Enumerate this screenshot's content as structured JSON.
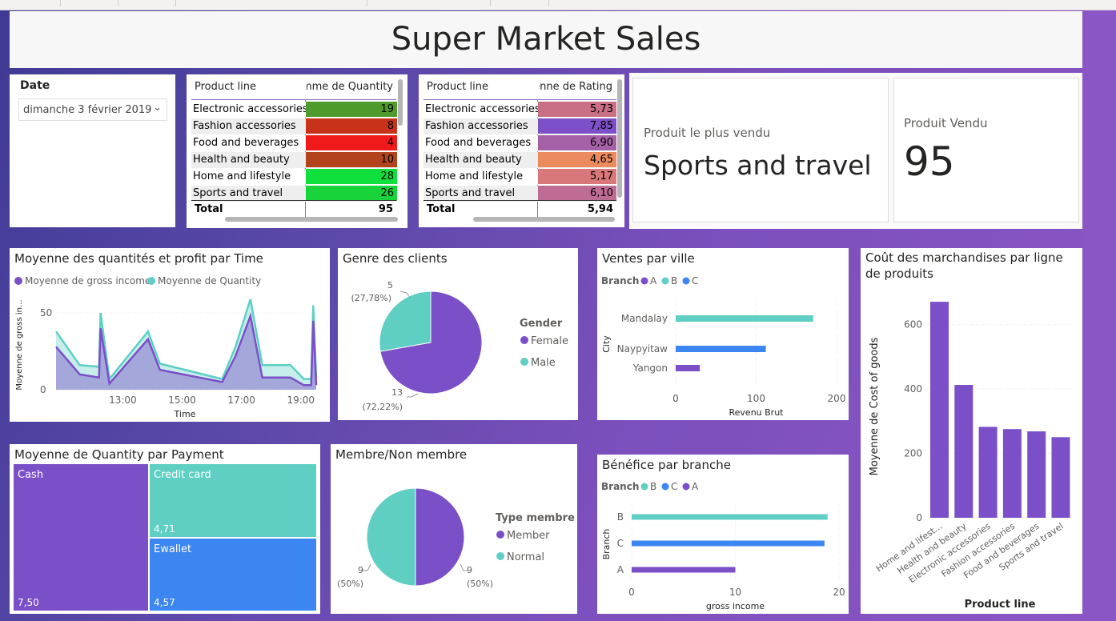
{
  "header": {
    "title": "Super Market Sales"
  },
  "date_slicer": {
    "label": "Date",
    "value": "dimanche 3 février 2019"
  },
  "qty_table": {
    "col1": "Product line",
    "col2": "mme de Quantity",
    "rows": [
      {
        "name": "Electronic accessories",
        "value": "19",
        "color": "#4f9a2c"
      },
      {
        "name": "Fashion accessories",
        "value": "8",
        "color": "#c8321a"
      },
      {
        "name": "Food and beverages",
        "value": "4",
        "color": "#f01a1a"
      },
      {
        "name": "Health and beauty",
        "value": "10",
        "color": "#b2431d"
      },
      {
        "name": "Home and lifestyle",
        "value": "28",
        "color": "#10e03c"
      },
      {
        "name": "Sports and travel",
        "value": "26",
        "color": "#19d33a"
      }
    ],
    "total_label": "Total",
    "total_value": "95"
  },
  "rating_table": {
    "col1": "Product line",
    "col2": "enne de Rating",
    "rows": [
      {
        "name": "Electronic accessories",
        "value": "5,73",
        "color": "#c96f86"
      },
      {
        "name": "Fashion accessories",
        "value": "7,85",
        "color": "#7d4fc8"
      },
      {
        "name": "Food and beverages",
        "value": "6,90",
        "color": "#a561a6"
      },
      {
        "name": "Health and beauty",
        "value": "4,65",
        "color": "#ec8b5e"
      },
      {
        "name": "Home and lifestyle",
        "value": "5,17",
        "color": "#d9787a"
      },
      {
        "name": "Sports and travel",
        "value": "6,10",
        "color": "#be6c93"
      }
    ],
    "total_label": "Total",
    "total_value": "5,94"
  },
  "card_top_product": {
    "label": "Produit le plus vendu",
    "value": "Sports and travel"
  },
  "card_sold": {
    "label": "Produit Vendu",
    "value": "95"
  },
  "visuals": {
    "time_chart": "Moyenne des quantités et profit par Time",
    "gender": "Genre des clients",
    "city": "Ventes par ville",
    "cogs": "Coût des marchandises par ligne de produits",
    "payment": "Moyenne de Quantity par Payment",
    "member": "Membre/Non membre",
    "branch_profit": "Bénéfice par branche"
  },
  "chart_data": [
    {
      "type": "area",
      "title": "Moyenne des quantités et profit par Time",
      "xlabel": "Time",
      "ylabel": "Moyenne de gross in...",
      "x_ticks": [
        "13:00",
        "15:00",
        "17:00",
        "19:00"
      ],
      "y_ticks": [
        "0",
        "50"
      ],
      "ylim": [
        0,
        60
      ],
      "series": [
        {
          "name": "Moyenne de gross income",
          "color": "#7b4fc8",
          "points": [
            [
              10.75,
              28
            ],
            [
              11.55,
              10
            ],
            [
              12.2,
              8
            ],
            [
              12.25,
              40
            ],
            [
              12.55,
              4
            ],
            [
              13.85,
              33
            ],
            [
              14.25,
              13
            ],
            [
              16.35,
              5
            ],
            [
              16.8,
              22
            ],
            [
              17.3,
              48
            ],
            [
              17.7,
              8
            ],
            [
              18.65,
              8
            ],
            [
              19.1,
              3
            ],
            [
              19.35,
              3
            ],
            [
              19.42,
              45
            ],
            [
              19.52,
              3
            ]
          ]
        },
        {
          "name": "Moyenne de Quantity",
          "color": "#5fcfc4",
          "points": [
            [
              10.75,
              38
            ],
            [
              11.55,
              16
            ],
            [
              12.2,
              15
            ],
            [
              12.25,
              50
            ],
            [
              12.55,
              7
            ],
            [
              13.85,
              38
            ],
            [
              14.25,
              17
            ],
            [
              16.35,
              7
            ],
            [
              16.8,
              28
            ],
            [
              17.3,
              59
            ],
            [
              17.7,
              16
            ],
            [
              18.65,
              16
            ],
            [
              19.1,
              7
            ],
            [
              19.35,
              7
            ],
            [
              19.42,
              55
            ],
            [
              19.52,
              7
            ]
          ]
        }
      ]
    },
    {
      "type": "pie",
      "title": "Genre des clients",
      "legend_title": "Gender",
      "slices": [
        {
          "name": "Female",
          "value": 13,
          "label": "13",
          "pct": "(72,22%)",
          "color": "#7b4fc8"
        },
        {
          "name": "Male",
          "value": 5,
          "label": "5",
          "pct": "(27,78%)",
          "color": "#5fcfc4"
        }
      ]
    },
    {
      "type": "bar",
      "title": "Ventes par ville",
      "orientation": "horizontal",
      "legend_title": "Branch",
      "legend": [
        {
          "name": "A",
          "color": "#7b4fc8"
        },
        {
          "name": "B",
          "color": "#5fcfc4"
        },
        {
          "name": "C",
          "color": "#3b86f0"
        }
      ],
      "categories": [
        "Mandalay",
        "Naypyitaw",
        "Yangon"
      ],
      "values": [
        171,
        112,
        30
      ],
      "colors": [
        "#5fcfc4",
        "#3b86f0",
        "#7b4fc8"
      ],
      "xlabel": "Revenu Brut",
      "ylabel": "City",
      "x_ticks": [
        "0",
        "100",
        "200"
      ],
      "xlim": [
        0,
        200
      ]
    },
    {
      "type": "bar",
      "title": "Coût des marchandises par ligne de produits",
      "categories": [
        "Home and lifest...",
        "Health and beauty",
        "Electronic accessories",
        "Fashion accessories",
        "Food and beverages",
        "Sports and travel"
      ],
      "values": [
        670,
        412,
        282,
        275,
        268,
        250
      ],
      "color": "#7b4fc8",
      "xlabel": "Product line",
      "ylabel": "Moyenne de Cost of goods",
      "y_ticks": [
        "0",
        "200",
        "400",
        "600"
      ],
      "ylim": [
        0,
        700
      ]
    },
    {
      "type": "treemap",
      "title": "Moyenne de Quantity par Payment",
      "items": [
        {
          "name": "Cash",
          "value": "7,50",
          "color": "#7b4fc8"
        },
        {
          "name": "Credit card",
          "value": "4,71",
          "color": "#5fcfc4"
        },
        {
          "name": "Ewallet",
          "value": "4,57",
          "color": "#3b86f0"
        }
      ]
    },
    {
      "type": "pie",
      "title": "Membre/Non membre",
      "legend_title": "Type membre",
      "slices": [
        {
          "name": "Member",
          "value": 9,
          "label": "9",
          "pct": "(50%)",
          "color": "#7b4fc8"
        },
        {
          "name": "Normal",
          "value": 9,
          "label": "9",
          "pct": "(50%)",
          "color": "#5fcfc4"
        }
      ]
    },
    {
      "type": "bar",
      "title": "Bénéfice par branche",
      "orientation": "horizontal",
      "legend_title": "Branch",
      "legend": [
        {
          "name": "B",
          "color": "#5fcfc4"
        },
        {
          "name": "C",
          "color": "#3b86f0"
        },
        {
          "name": "A",
          "color": "#7b4fc8"
        }
      ],
      "categories": [
        "B",
        "C",
        "A"
      ],
      "values": [
        18.9,
        18.6,
        10.0
      ],
      "colors": [
        "#5fcfc4",
        "#3b86f0",
        "#7b4fc8"
      ],
      "xlabel": "gross income",
      "ylabel": "Branch",
      "x_ticks": [
        "0",
        "10",
        "20"
      ],
      "xlim": [
        0,
        20
      ]
    }
  ]
}
